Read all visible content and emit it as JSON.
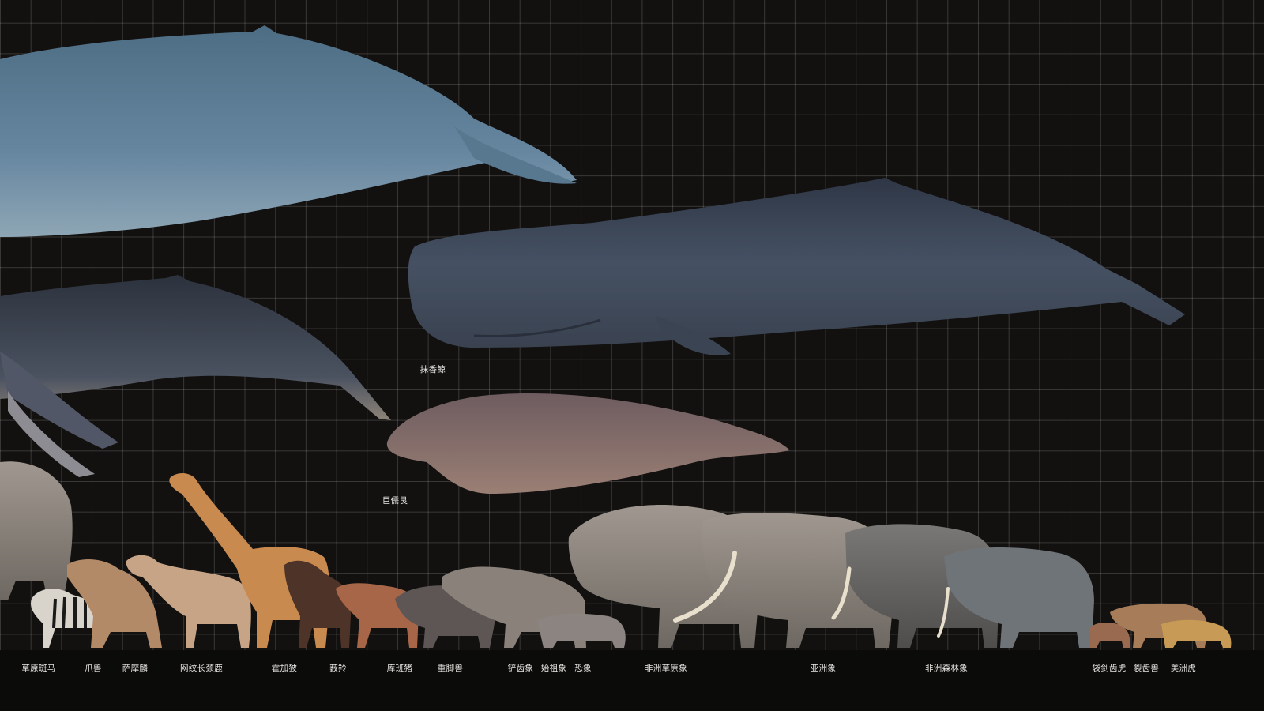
{
  "floating_labels": {
    "sperm_whale": "抹香鲸",
    "steller_sea_cow": "巨儒艮"
  },
  "bottom_labels": [
    "草原斑马",
    "爪兽",
    "萨摩麟",
    "网纹长颈鹿",
    "霍加狓",
    "薮羚",
    "库班猪",
    "重脚兽",
    "铲齿象",
    "始祖象",
    "恐象",
    "非洲草原象",
    "亚洲象",
    "非洲森林象",
    "袋剑齿虎",
    "裂齿兽",
    "美洲虎"
  ],
  "colors": {
    "background": "#121110",
    "grid_line": "#3a3836",
    "ground": "#0b0b0a",
    "label_text": "#e8e6e2",
    "blue_whale": "#5b7d93",
    "sperm_whale": "#3f4a5a",
    "humpback_whale": "#3b4250",
    "sea_cow": "#7d6a6a",
    "elephant_gray": "#8a8580"
  }
}
